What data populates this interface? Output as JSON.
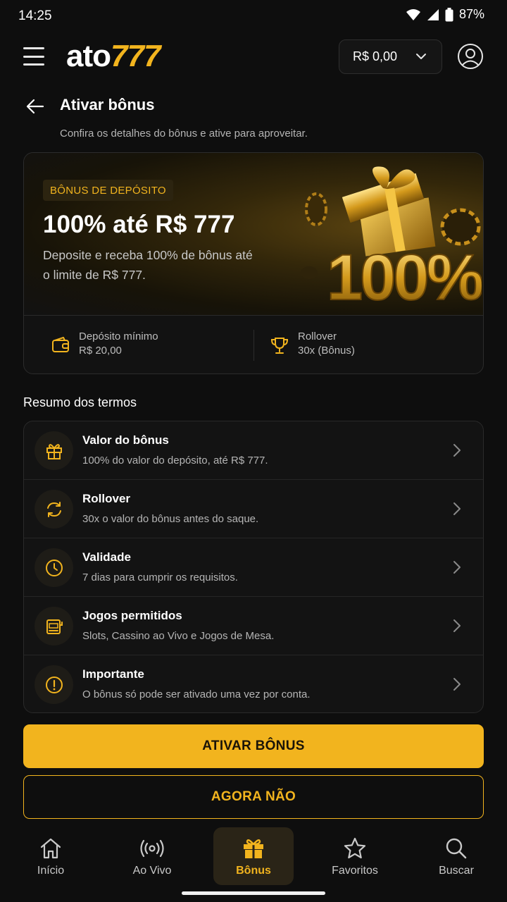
{
  "status_bar": {
    "time": "14:25",
    "battery": "87%"
  },
  "header": {
    "logo_part1": "ato",
    "logo_part2": "777",
    "balance": "R$ 0,00"
  },
  "page": {
    "title": "Ativar bônus",
    "subtitle": "Confira os detalhes do bônus e ative para aproveitar."
  },
  "promo": {
    "badge": "BÔNUS DE DEPÓSITO",
    "headline": "100% até R$ 777",
    "description": "Deposite e receba 100% de bônus até o limite de R$ 777.",
    "art_text": "100%",
    "min_deposit_label": "Depósito mínimo",
    "min_deposit_value": "R$ 20,00",
    "rollover_label": "Rollover",
    "rollover_value": "30x (Bônus)"
  },
  "terms": {
    "heading": "Resumo dos termos",
    "items": [
      {
        "title": "Valor do bônus",
        "desc": "100% do valor do depósito, até R$ 777.",
        "icon": "gift-icon"
      },
      {
        "title": "Rollover",
        "desc": "30x o valor do bônus antes do saque.",
        "icon": "refresh-icon"
      },
      {
        "title": "Validade",
        "desc": "7 dias para cumprir os requisitos.",
        "icon": "clock-icon"
      },
      {
        "title": "Jogos permitidos",
        "desc": "Slots, Cassino ao Vivo e Jogos de Mesa.",
        "icon": "slot-machine-icon"
      },
      {
        "title": "Importante",
        "desc": "O bônus só pode ser ativado uma vez por conta.",
        "icon": "alert-icon"
      }
    ]
  },
  "actions": {
    "primary": "ATIVAR BÔNUS",
    "secondary": "AGORA NÃO"
  },
  "nav": {
    "items": [
      {
        "label": "Início",
        "icon": "home-icon"
      },
      {
        "label": "Ao Vivo",
        "icon": "live-icon"
      },
      {
        "label": "Bônus",
        "icon": "gift-icon"
      },
      {
        "label": "Favoritos",
        "icon": "star-icon"
      },
      {
        "label": "Buscar",
        "icon": "search-icon"
      }
    ],
    "active": "Bônus"
  },
  "colors": {
    "accent": "#f2b41e",
    "background": "#0e0e0e"
  }
}
